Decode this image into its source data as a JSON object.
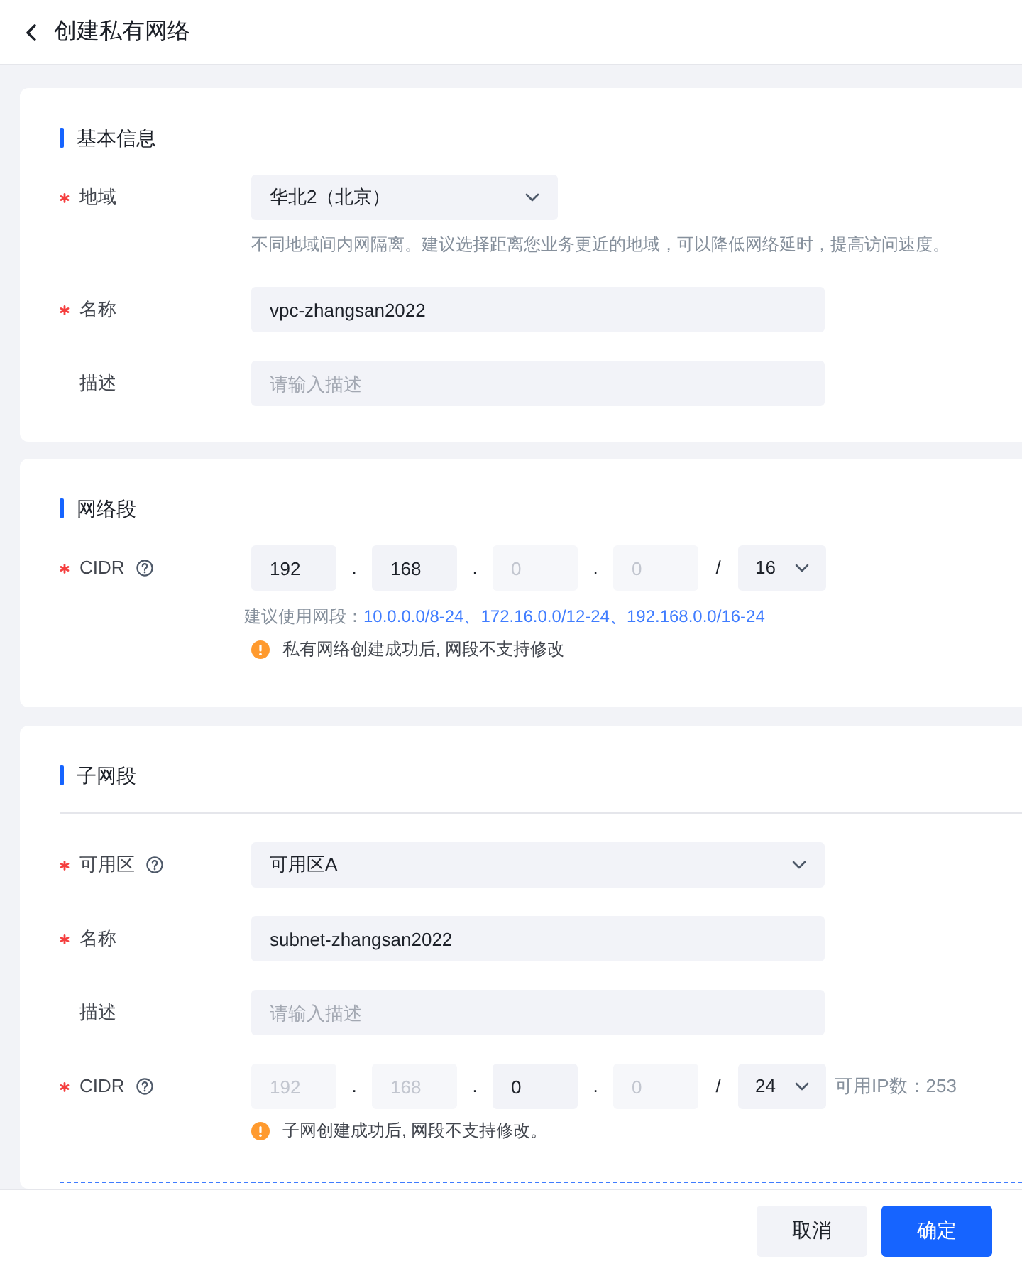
{
  "header": {
    "title": "创建私有网络"
  },
  "sections": [
    {
      "title": "基本信息",
      "divider": false,
      "fields": [
        {
          "kind": "region",
          "label": "地域",
          "required": true,
          "help": false,
          "value": "华北2（北京）",
          "hint": "不同地域间内网隔离。建议选择距离您业务更近的地域，可以降低网络延时，提高访问速度。"
        },
        {
          "kind": "text",
          "label": "名称",
          "required": true,
          "help": false,
          "value": "vpc-zhangsan2022"
        },
        {
          "kind": "text",
          "label": "描述",
          "required": false,
          "help": false,
          "placeholder": "请输入描述"
        }
      ]
    },
    {
      "title": "网络段",
      "divider": false,
      "fields": [
        {
          "kind": "cidr",
          "label": "CIDR",
          "required": true,
          "help": true,
          "octets": [
            {
              "value": "192",
              "disabled": false
            },
            {
              "value": "168",
              "disabled": false
            },
            {
              "value": "0",
              "disabled": true
            },
            {
              "value": "0",
              "disabled": true
            }
          ],
          "dots": [
            ".",
            ".",
            "."
          ],
          "slash": "/",
          "mask": "16",
          "suggestion": {
            "label": "建议使用网段：",
            "ranges": "10.0.0.0/8-24、172.16.0.0/12-24、192.168.0.0/16-24"
          },
          "warning": "私有网络创建成功后, 网段不支持修改"
        }
      ]
    },
    {
      "title": "子网段",
      "divider": true,
      "fields": [
        {
          "kind": "select",
          "label": "可用区",
          "required": true,
          "help": true,
          "value": "可用区A"
        },
        {
          "kind": "text",
          "label": "名称",
          "required": true,
          "help": false,
          "value": "subnet-zhangsan2022"
        },
        {
          "kind": "text",
          "label": "描述",
          "required": false,
          "help": false,
          "placeholder": "请输入描述"
        },
        {
          "kind": "cidr",
          "label": "CIDR",
          "required": true,
          "help": true,
          "octets": [
            {
              "value": "192",
              "disabled": true
            },
            {
              "value": "168",
              "disabled": true
            },
            {
              "value": "0",
              "disabled": false
            },
            {
              "value": "0",
              "disabled": true
            }
          ],
          "dots": [
            ".",
            ".",
            "."
          ],
          "slash": "/",
          "mask": "24",
          "available": "可用IP数：253",
          "warning": "子网创建成功后, 网段不支持修改。"
        }
      ]
    }
  ],
  "footer": {
    "buttons": [
      {
        "label": "取消",
        "kind": "secondary"
      },
      {
        "label": "确定",
        "kind": "primary"
      }
    ]
  }
}
